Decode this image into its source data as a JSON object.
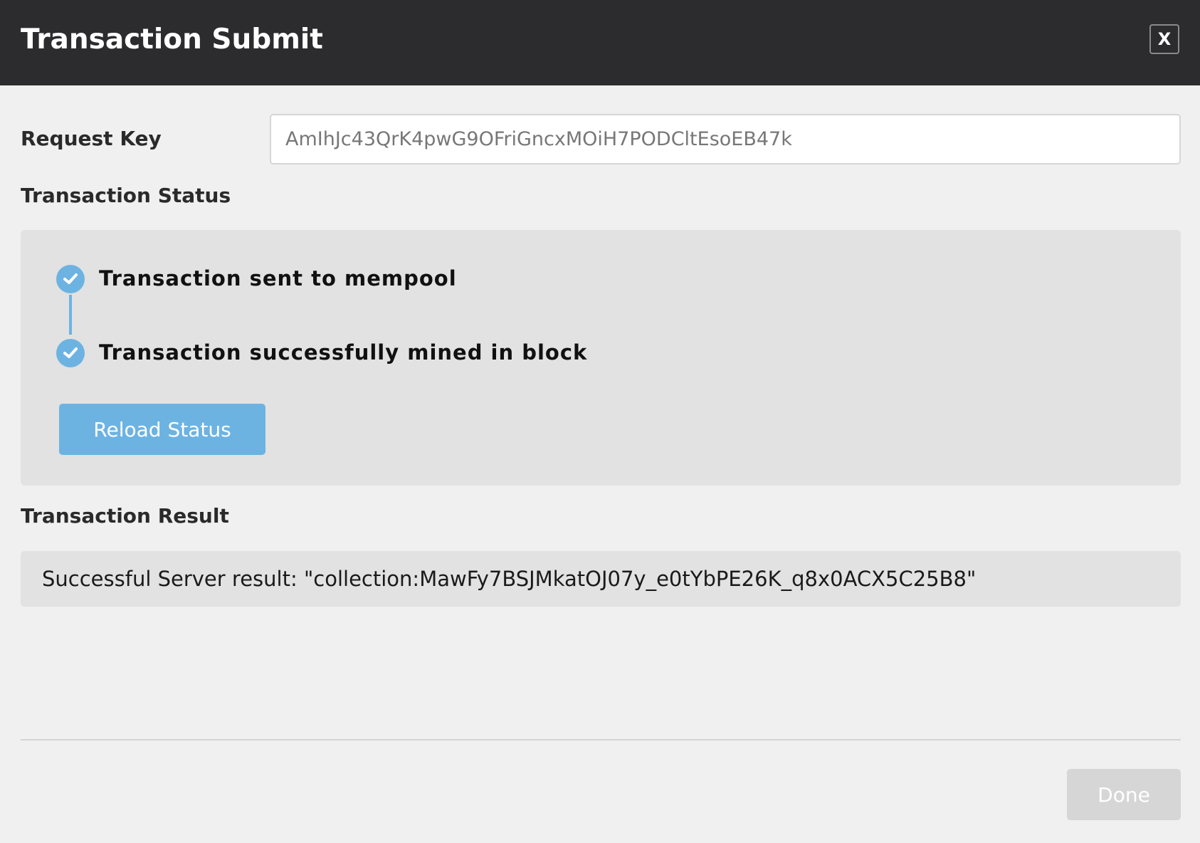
{
  "modal": {
    "title": "Transaction Submit",
    "close_label": "X"
  },
  "request_key": {
    "label": "Request Key",
    "value": "AmIhJc43QrK4pwG9OFriGncxMOiH7PODCltEsoEB47k"
  },
  "status": {
    "heading": "Transaction Status",
    "steps": [
      {
        "label": "Transaction sent to mempool",
        "state": "complete",
        "icon": "check-circle-icon"
      },
      {
        "label": "Transaction successfully mined in block",
        "state": "complete",
        "icon": "check-circle-icon"
      }
    ],
    "reload_label": "Reload Status"
  },
  "result": {
    "heading": "Transaction Result",
    "text": "Successful Server result: \"collection:MawFy7BSJMkatOJ07y_e0tYbPE26K_q8x0ACX5C25B8\""
  },
  "footer": {
    "done_label": "Done",
    "done_enabled": false
  },
  "colors": {
    "header_bg": "#2c2c2e",
    "accent": "#6db3e2",
    "panel_bg": "#e2e2e2",
    "page_bg": "#f0f0f0",
    "disabled_button": "#d6d6d6"
  }
}
